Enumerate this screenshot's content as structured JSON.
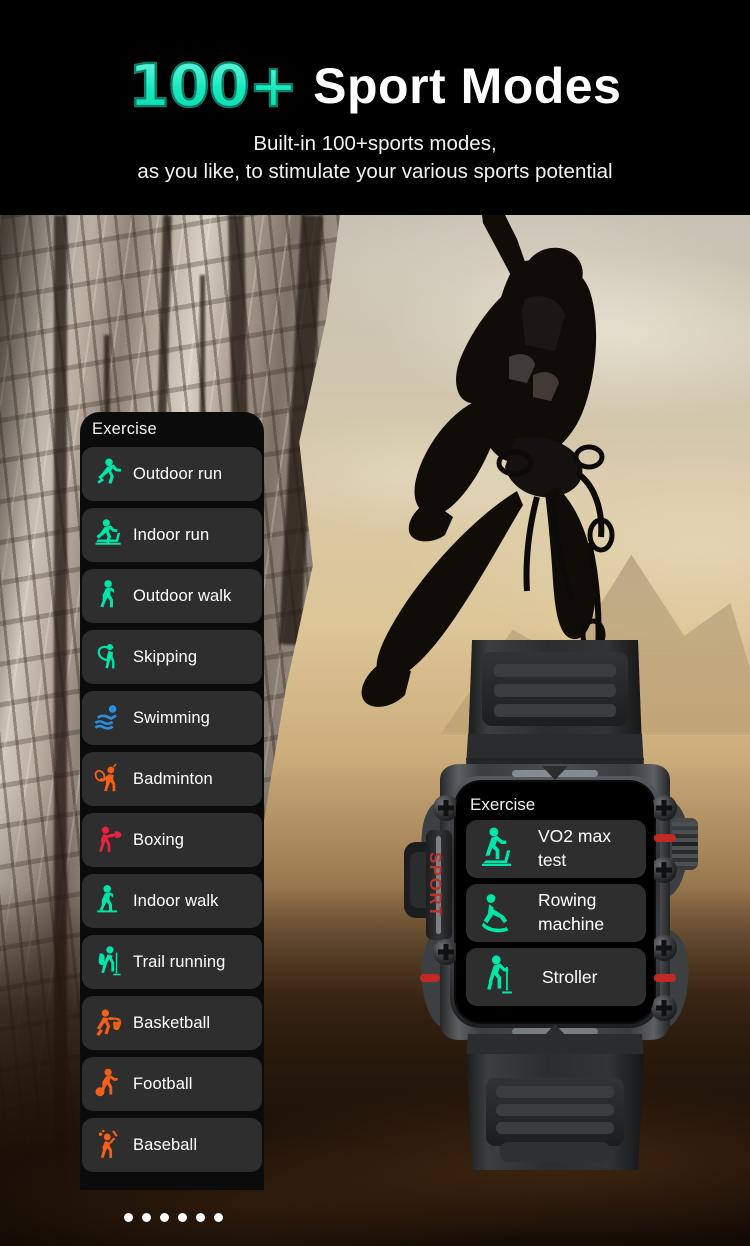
{
  "header": {
    "highlight": "100+",
    "title": "Sport Modes",
    "subtitle_line1": "Built-in 100+sports modes,",
    "subtitle_line2": "as you like, to stimulate your various sports potential"
  },
  "colors": {
    "accent_green": "#00e6a8",
    "accent_teal": "#18e8bd",
    "accent_blue": "#2b8fe0",
    "accent_orange": "#f4601a",
    "accent_red": "#e8213f",
    "panel_bg": "#0b0b0b",
    "item_bg": "#2e2e2e",
    "text": "#ffffff"
  },
  "sports_panel": {
    "title": "Exercise",
    "items": [
      {
        "label": "Outdoor run",
        "icon": "runner-outdoor-icon",
        "color": "#00e6a8"
      },
      {
        "label": "Indoor run",
        "icon": "treadmill-icon",
        "color": "#00e6a8"
      },
      {
        "label": "Outdoor walk",
        "icon": "walker-outdoor-icon",
        "color": "#00e6a8"
      },
      {
        "label": "Skipping",
        "icon": "jump-rope-icon",
        "color": "#00e6a8"
      },
      {
        "label": "Swimming",
        "icon": "swimmer-icon",
        "color": "#2b8fe0"
      },
      {
        "label": "Badminton",
        "icon": "badminton-icon",
        "color": "#f4601a"
      },
      {
        "label": "Boxing",
        "icon": "boxing-icon",
        "color": "#e8213f"
      },
      {
        "label": "Indoor walk",
        "icon": "walker-indoor-icon",
        "color": "#00e6a8"
      },
      {
        "label": "Trail running",
        "icon": "trail-hiker-icon",
        "color": "#00e6a8"
      },
      {
        "label": "Basketball",
        "icon": "basketball-icon",
        "color": "#f4601a"
      },
      {
        "label": "Football",
        "icon": "football-icon",
        "color": "#f4601a"
      },
      {
        "label": "Baseball",
        "icon": "baseball-icon",
        "color": "#f4601a"
      }
    ]
  },
  "watch": {
    "side_button_label": "SPORT",
    "screen": {
      "title": "Exercise",
      "items": [
        {
          "label": "VO2 max test",
          "icon": "treadmill-icon",
          "color": "#00e6a8"
        },
        {
          "label": "Rowing machine",
          "icon": "rowing-machine-icon",
          "color": "#00e6a8"
        },
        {
          "label": "Stroller",
          "icon": "stroller-walker-icon",
          "color": "#00e6a8"
        }
      ]
    }
  },
  "pagination": {
    "count": 6,
    "active_index": 0
  }
}
